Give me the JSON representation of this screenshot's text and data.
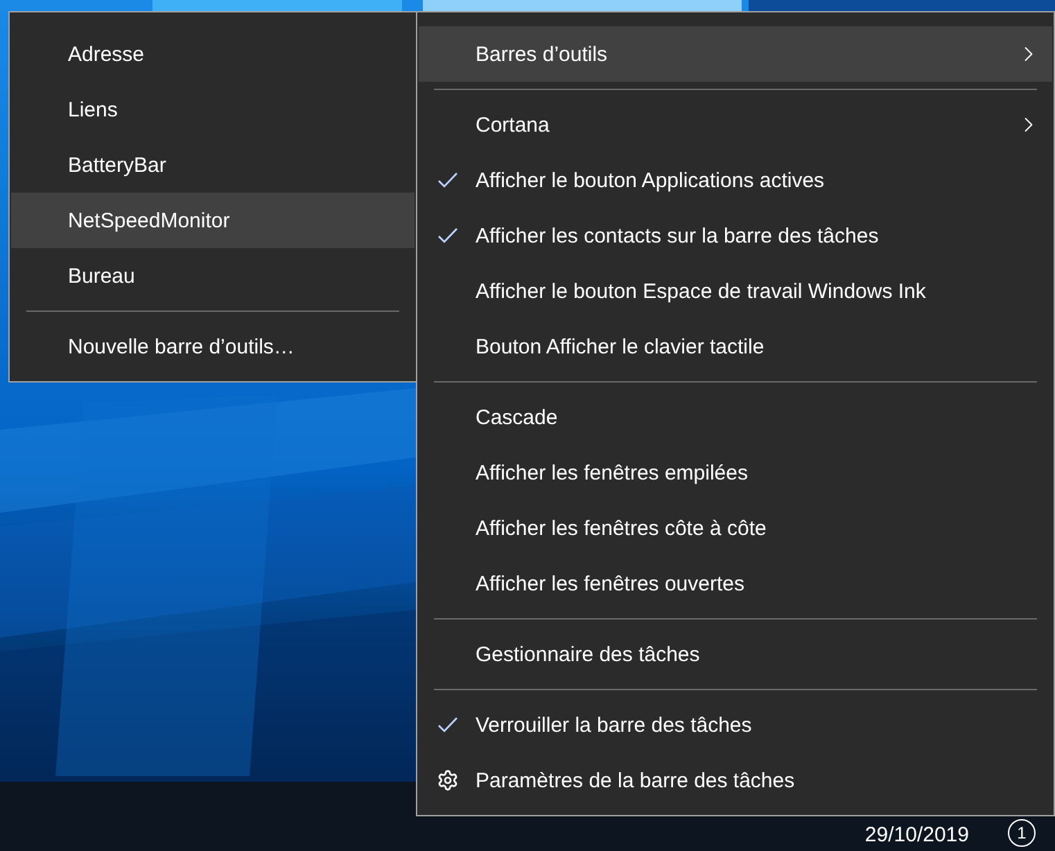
{
  "toolbars_submenu": {
    "items": [
      {
        "kind": "item",
        "label": "Adresse",
        "selected": false
      },
      {
        "kind": "item",
        "label": "Liens",
        "selected": false
      },
      {
        "kind": "item",
        "label": "BatteryBar",
        "selected": false
      },
      {
        "kind": "item",
        "label": "NetSpeedMonitor",
        "selected": true
      },
      {
        "kind": "item",
        "label": "Bureau",
        "selected": false
      },
      {
        "kind": "separator"
      },
      {
        "kind": "item",
        "label": "Nouvelle barre d’outils…",
        "selected": false
      }
    ]
  },
  "context_menu": {
    "items": [
      {
        "kind": "item",
        "label": "Barres d’outils",
        "selected": true,
        "checked": false,
        "has_submenu": true
      },
      {
        "kind": "separator"
      },
      {
        "kind": "item",
        "label": "Cortana",
        "selected": false,
        "checked": false,
        "has_submenu": true
      },
      {
        "kind": "item",
        "label": "Afficher le bouton Applications actives",
        "selected": false,
        "checked": true,
        "has_submenu": false
      },
      {
        "kind": "item",
        "label": "Afficher les contacts sur la barre des tâches",
        "selected": false,
        "checked": true,
        "has_submenu": false
      },
      {
        "kind": "item",
        "label": "Afficher le bouton Espace de travail Windows Ink",
        "selected": false,
        "checked": false,
        "has_submenu": false
      },
      {
        "kind": "item",
        "label": "Bouton Afficher le clavier tactile",
        "selected": false,
        "checked": false,
        "has_submenu": false
      },
      {
        "kind": "separator"
      },
      {
        "kind": "item",
        "label": "Cascade",
        "selected": false,
        "checked": false,
        "has_submenu": false
      },
      {
        "kind": "item",
        "label": "Afficher les fenêtres empilées",
        "selected": false,
        "checked": false,
        "has_submenu": false
      },
      {
        "kind": "item",
        "label": "Afficher les fenêtres côte à côte",
        "selected": false,
        "checked": false,
        "has_submenu": false
      },
      {
        "kind": "item",
        "label": "Afficher les fenêtres ouvertes",
        "selected": false,
        "checked": false,
        "has_submenu": false
      },
      {
        "kind": "separator"
      },
      {
        "kind": "item",
        "label": "Gestionnaire des tâches",
        "selected": false,
        "checked": false,
        "has_submenu": false
      },
      {
        "kind": "separator"
      },
      {
        "kind": "item",
        "label": "Verrouiller la barre des tâches",
        "selected": false,
        "checked": true,
        "has_submenu": false
      },
      {
        "kind": "settings",
        "label": "Paramètres de la barre des tâches",
        "selected": false,
        "has_submenu": false
      }
    ]
  },
  "taskbar": {
    "date": "29/10/2019",
    "notification_count": "1"
  }
}
